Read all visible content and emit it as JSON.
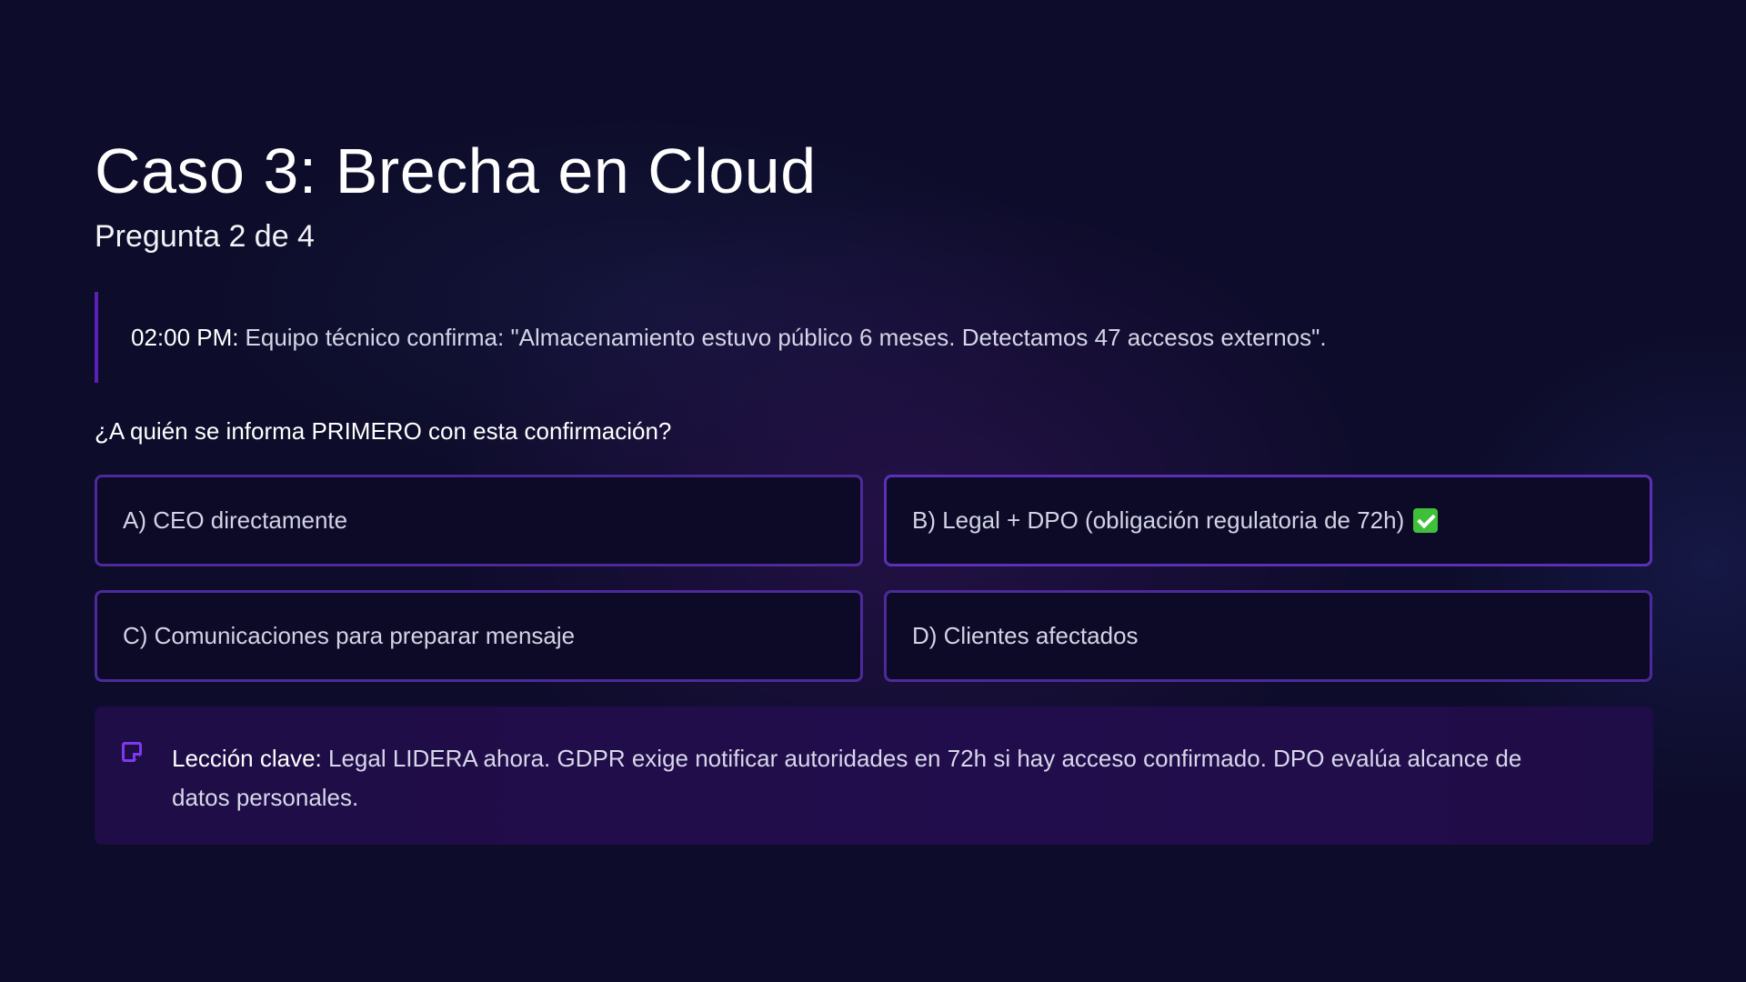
{
  "slide": {
    "title": "Caso 3: Brecha en Cloud",
    "subtitle": "Pregunta 2 de 4"
  },
  "update": {
    "time": "02:00 PM:",
    "text": "Equipo técnico confirma: \"Almacenamiento estuvo público 6 meses. Detectamos 47 accesos externos\"."
  },
  "question": "¿A quién se informa PRIMERO con esta confirmación?",
  "options": [
    {
      "label": "A) CEO directamente"
    },
    {
      "label": "B) Legal + DPO (obligación regulatoria de 72h)",
      "marker": "check-mark-icon",
      "marker_color": "#3fbf3a"
    },
    {
      "label": "C) Comunicaciones para preparar mensaje"
    },
    {
      "label": "D) Clientes afectados"
    }
  ],
  "lesson": {
    "icon": "note-icon",
    "label": "Lección clave:",
    "text": "Legal LIDERA ahora. GDPR exige notificar autoridades en 72h si hay acceso confirmado. DPO evalúa alcance de datos personales."
  },
  "colors": {
    "background": "#0d0c2a",
    "accent": "#5b21b6",
    "option_border": "#4c2a9a",
    "lesson_background": "#220d4c"
  }
}
